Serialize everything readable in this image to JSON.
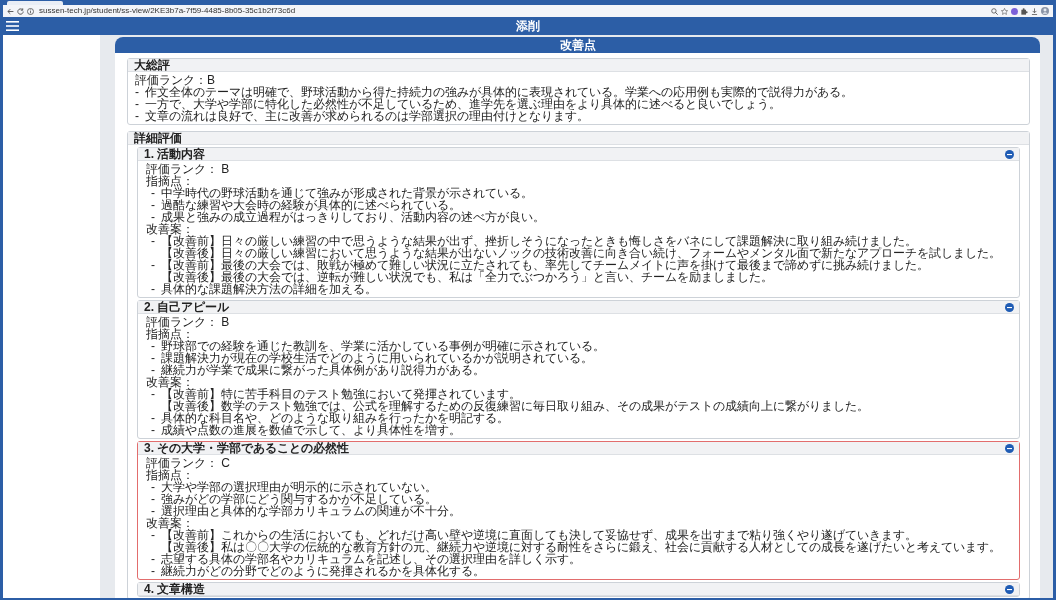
{
  "browser": {
    "url": "sussen-tech.jp/student/ss-view/2KE3b7a-7f59-4485-8b05-35c1b2f73c6d"
  },
  "header": {
    "title": "添削"
  },
  "panel": {
    "title": "改善点"
  },
  "summary": {
    "title": "大総評",
    "rank": "評価ランク：B",
    "points": [
      {
        "marker": "-",
        "text": "作文全体のテーマは明確で、野球活動から得た持続力の強みが具体的に表現されている。学業への応用例も実際的で説得力がある。"
      },
      {
        "marker": "-",
        "text": "一方で、大学や学部に特化した必然性が不足しているため、進学先を選ぶ理由をより具体的に述べると良いでしょう。"
      },
      {
        "marker": "-",
        "text": "文章の流れは良好で、主に改善が求められるのは学部選択の理由付けとなります。"
      }
    ]
  },
  "details": {
    "title": "詳細評価",
    "sections": [
      {
        "title": "1. 活動内容",
        "expanded": true,
        "flagged": false,
        "rank": "評価ランク： B",
        "issues_label": "指摘点：",
        "issues": [
          {
            "marker": "-",
            "text": "中学時代の野球活動を通じて強みが形成された背景が示されている。"
          },
          {
            "marker": "-",
            "text": "過酷な練習や大会時の経験が具体的に述べられている。"
          },
          {
            "marker": "-",
            "text": "成果と強みの成立過程がはっきりしており、活動内容の述べ方が良い。"
          }
        ],
        "improvements_label": "改善案：",
        "improvements": [
          {
            "kind": "rewrite",
            "marker": "-",
            "before": "【改善前】日々の厳しい練習の中で思うような結果が出ず、挫折しそうになったときも悔しさをバネにして課題解決に取り組み続けました。",
            "after": "【改善後】日々の厳しい練習において思うような結果が出ないノックの技術改善に向き合い続け、フォームやメンタル面で新たなアプローチを試しました。"
          },
          {
            "kind": "rewrite",
            "marker": "-",
            "before": "【改善前】最後の大会では、敗戦が極めて難しい状況に立たされても、率先してチームメイトに声を掛けて最後まで諦めずに挑み続けました。",
            "after": "【改善後】最後の大会では、逆転が難しい状況でも、私は「全力でぶつかろう」と言い、チームを励ましました。"
          },
          {
            "kind": "note",
            "marker": "-",
            "text": "具体的な課題解決方法の詳細を加える。"
          }
        ]
      },
      {
        "title": "2. 自己アピール",
        "expanded": true,
        "flagged": false,
        "rank": "評価ランク： B",
        "issues_label": "指摘点：",
        "issues": [
          {
            "marker": "-",
            "text": "野球部での経験を通じた教訓を、学業に活かしている事例が明確に示されている。"
          },
          {
            "marker": "-",
            "text": "課題解決力が現在の学校生活でどのように用いられているかが説明されている。"
          },
          {
            "marker": "-",
            "text": "継続力が学業で成果に繋がった具体例があり説得力がある。"
          }
        ],
        "improvements_label": "改善案：",
        "improvements": [
          {
            "kind": "rewrite",
            "marker": "-",
            "before": "【改善前】特に苦手科目のテスト勉強において発揮されています。",
            "after": "【改善後】数学のテスト勉強では、公式を理解するための反復練習に毎日取り組み、その成果がテストの成績向上に繋がりました。"
          },
          {
            "kind": "note",
            "marker": "-",
            "text": "具体的な科目名や、どのような取り組みを行ったかを明記する。"
          },
          {
            "kind": "note",
            "marker": "-",
            "text": "成績や点数の進展を数値で示して、より具体性を増す。"
          }
        ]
      },
      {
        "title": "3. その大学・学部であることの必然性",
        "expanded": true,
        "flagged": true,
        "rank": "評価ランク： C",
        "issues_label": "指摘点：",
        "issues": [
          {
            "marker": "-",
            "text": "大学や学部の選択理由が明示的に示されていない。"
          },
          {
            "marker": "-",
            "text": "強みがどの学部にどう関与するかが不足している。"
          },
          {
            "marker": "-",
            "text": "選択理由と具体的な学部カリキュラムの関連が不十分。"
          }
        ],
        "improvements_label": "改善案：",
        "improvements": [
          {
            "kind": "rewrite",
            "marker": "-",
            "before": "【改善前】これからの生活においても、どれだけ高い壁や逆境に直面しても決して妥協せず、成果を出すまで粘り強くやり遂げていきます。",
            "after": "【改善後】私は〇〇大学の伝統的な教育方針の元、継続力や逆境に対する耐性をさらに鍛え、社会に貢献する人材としての成長を遂げたいと考えています。"
          },
          {
            "kind": "note",
            "marker": "-",
            "text": "志望する具体の学部名やカリキュラムを記述し、その選択理由を詳しく示す。"
          },
          {
            "kind": "note",
            "marker": "-",
            "text": "継続力がどの分野でどのように発揮されるかを具体化する。"
          }
        ]
      },
      {
        "title": "4. 文章構造",
        "expanded": true,
        "flagged": false
      }
    ]
  }
}
